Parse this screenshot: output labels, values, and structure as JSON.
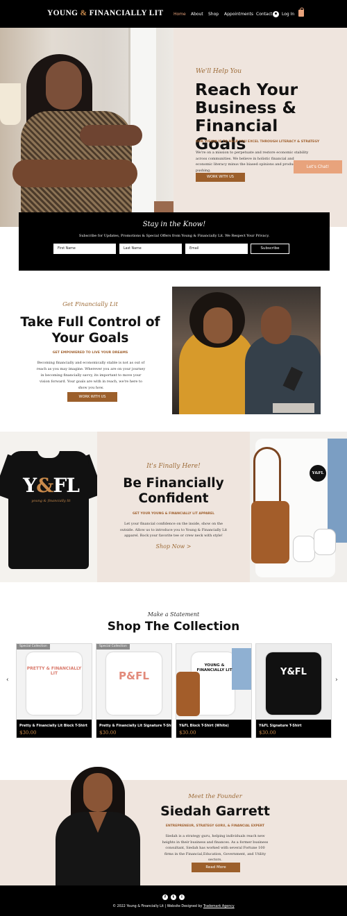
{
  "header": {
    "logo_part1": "YOUNG",
    "logo_amp": "&",
    "logo_part2": "FINANCIALLY LIT",
    "nav": [
      "Home",
      "About",
      "Shop",
      "Appointments",
      "Contact"
    ],
    "login_label": "Log In",
    "active_color": "#e8a37c"
  },
  "hero": {
    "script": "We'll Help You",
    "title": "Reach Your Business & Financial Goals",
    "vision": "OUR VISION IS TO HELP YOU EXCEL THROUGH LITERACY & STRATEGY",
    "body": "We're on a mission to perpetuate and restore economic stability across communities. We believe in holistic financial and economic literacy minus the biased opinions and product pushing.",
    "button": "WORK WITH US",
    "chat_button": "Let's Chat!"
  },
  "newsletter": {
    "title": "Stay in the Know!",
    "subtitle": "Subscribe for Updates, Promotions & Special Offers from Young & Financially Lit. We Respect Your Privacy.",
    "first_name": "First Name",
    "last_name": "Last Name",
    "email": "Email",
    "button": "Subscribe"
  },
  "control": {
    "script": "Get Financially Lit",
    "title": "Take Full Control of Your Goals",
    "subtitle": "GET EMPOWERED TO LIVE YOUR DREAMS",
    "body": "Becoming financially and economically stable is not as out of reach as you may imagine. Wherever you are on your journey in becoming financially savvy, its important to move your vision forward. Your goals are with in reach, we're here to show you how.",
    "button": "WORK WITH US"
  },
  "apparel": {
    "shirt_logo_y": "Y",
    "shirt_logo_amp": "&",
    "shirt_logo_fl": "FL",
    "shirt_tagline": "young & financially lit",
    "script": "It's Finally Here!",
    "title": "Be Financially Confident",
    "subtitle": "GET YOUR YOUNG & FINANCIALLY LIT APPAREL",
    "body": "Let your financial confidence on the inside, show on the outside. Allow us to introduce you to Young & Financially Lit apparel. Rock your favorite tee or crew neck with style!",
    "link": "Shop Now >",
    "badge": "Y&FL"
  },
  "collection": {
    "script": "Make a Statement",
    "title": "Shop The Collection",
    "arrow_prev": "‹",
    "arrow_next": "›",
    "products": [
      {
        "ribbon": "Special Collection",
        "name": "Pretty & Financially Lit Block T-Shirt",
        "price": "$30.00",
        "shirt_text": "PRETTY & FINANCIALLY LIT"
      },
      {
        "ribbon": "Special Collection",
        "name": "Pretty & Financially Lit Signature T-Shirt",
        "price": "$30.00",
        "shirt_text": "P&FL"
      },
      {
        "ribbon": "",
        "name": "Y&FL Block T-Shirt (White)",
        "price": "$30.00",
        "shirt_text": "YOUNG & FINANCIALLY LIT"
      },
      {
        "ribbon": "",
        "name": "Y&FL Signature T-Shirt",
        "price": "$30.00",
        "shirt_text": "Y&FL"
      }
    ]
  },
  "founder": {
    "script": "Meet the Founder",
    "name": "Siedah Garrett",
    "role": "ENTREPRENEUR, STRATEGY GURU, & FINANCIAL EXPERT",
    "bio": "Siedah is a strategy guru, helping individuals reach new heights in their business and finances. As a former business consultant, Siedah has worked with several Fortune 100 firms in the Financial,Education, Government, and Utility sectors.",
    "button": "Read More"
  },
  "footer": {
    "social": [
      "f",
      "t",
      "i"
    ],
    "social_icons": [
      "facebook-icon",
      "twitter-icon",
      "instagram-icon"
    ],
    "copyright": "© 2022 Young & Financially Lit | Website Designed by",
    "designer": "Trademark Agency"
  },
  "colors": {
    "brand_brown": "#9c5f2b",
    "accent_peach": "#e8a37c",
    "panel_beige": "#efe5de"
  }
}
